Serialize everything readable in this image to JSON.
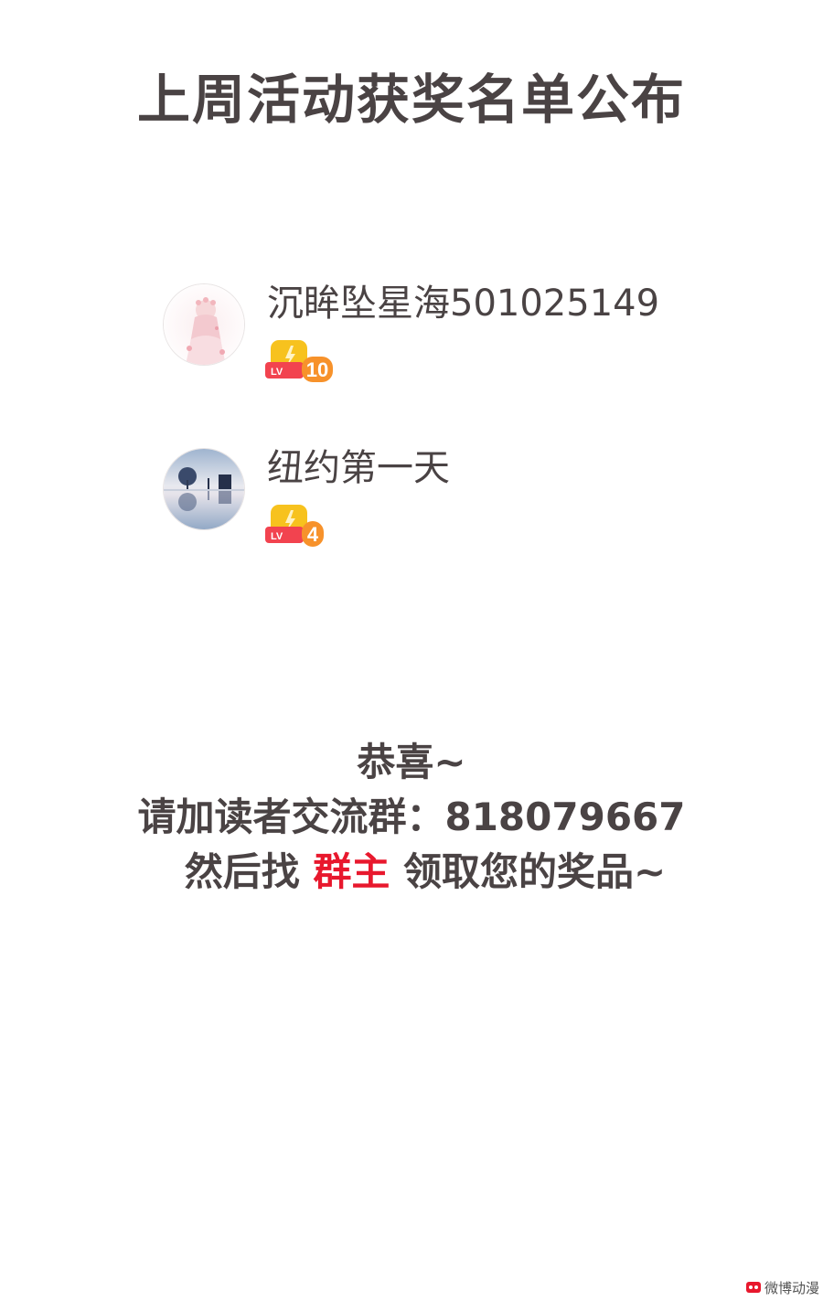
{
  "header": {
    "title": "上周活动获奖名单公布"
  },
  "winners": [
    {
      "name": "沉眸坠星海501025149",
      "level_label": "LV",
      "level": "10",
      "avatar_icon": "pink-floral-girl-avatar"
    },
    {
      "name": "纽约第一天",
      "level_label": "LV",
      "level": "4",
      "avatar_icon": "sky-reflection-avatar"
    }
  ],
  "announcement": {
    "line1": "恭喜~",
    "line2": "请加读者交流群：818079667",
    "line3_prefix": "然后找 ",
    "line3_highlight": "群主",
    "line3_suffix": " 领取您的奖品~",
    "highlight_color": "#e8182d"
  },
  "watermark": {
    "text": "微博动漫"
  },
  "colors": {
    "text": "#4a4344",
    "badge_gold": "#f7c21e",
    "badge_red": "#f2434f",
    "badge_orange": "#f7922b"
  }
}
